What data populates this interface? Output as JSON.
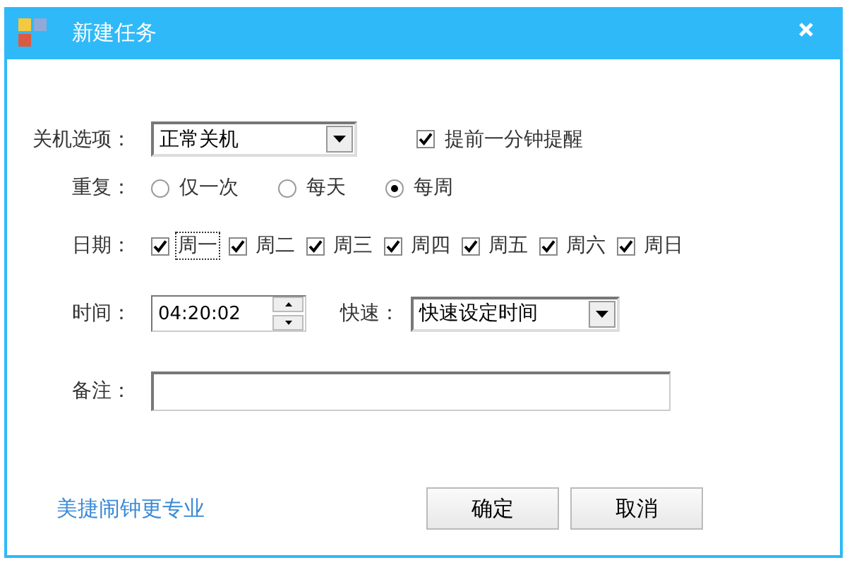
{
  "window": {
    "title": "新建任务"
  },
  "shutdown": {
    "label": "关机选项：",
    "value": "正常关机",
    "remind": {
      "label": "提前一分钟提醒",
      "checked": true
    }
  },
  "repeat": {
    "label": "重复：",
    "options": [
      {
        "label": "仅一次",
        "selected": false
      },
      {
        "label": "每天",
        "selected": false
      },
      {
        "label": "每周",
        "selected": true
      }
    ]
  },
  "date": {
    "label": "日期：",
    "days": [
      {
        "label": "周一",
        "checked": true,
        "focused": true
      },
      {
        "label": "周二",
        "checked": true,
        "focused": false
      },
      {
        "label": "周三",
        "checked": true,
        "focused": false
      },
      {
        "label": "周四",
        "checked": true,
        "focused": false
      },
      {
        "label": "周五",
        "checked": true,
        "focused": false
      },
      {
        "label": "周六",
        "checked": true,
        "focused": false
      },
      {
        "label": "周日",
        "checked": true,
        "focused": false
      }
    ]
  },
  "time": {
    "label": "时间：",
    "value": "04:20:02",
    "quick_label": "快速：",
    "quick_value": "快速设定时间"
  },
  "note": {
    "label": "备注："
  },
  "link": "美捷闹钟更专业",
  "buttons": [
    "确定",
    "取消"
  ]
}
